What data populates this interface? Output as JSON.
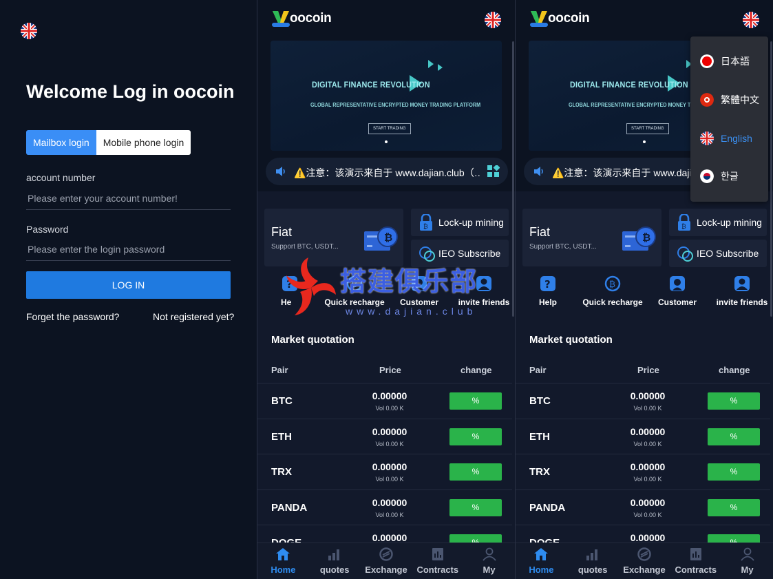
{
  "login": {
    "welcome": "Welcome Log in oocoin",
    "tabs": [
      "Mailbox login",
      "Mobile phone login"
    ],
    "account_label": "account number",
    "account_placeholder": "Please enter your account number!",
    "password_label": "Password",
    "password_placeholder": "Please enter the login password",
    "login_button": "LOG IN",
    "forget": "Forget the password?",
    "register": "Not registered yet?"
  },
  "home": {
    "brand": "oocoin",
    "banner": {
      "title": "DIGITAL FINANCE REVOLUTION",
      "subtitle": "GLOBAL REPRESENTATIVE ENCRYPTED MONEY TRADING PLATFORM",
      "button": "START TRADING"
    },
    "notice": "⚠️注意：该演示来自于 www.dajian.club（…",
    "fiat": {
      "title": "Fiat",
      "subtitle": "Support BTC, USDT..."
    },
    "services": [
      "Lock-up mining",
      "IEO Subscribe"
    ],
    "quick": [
      "Help",
      "Quick recharge",
      "Customer",
      "invite friends"
    ],
    "quick_partial": [
      "He",
      "Quick recharge",
      "Customer",
      "invite friends"
    ],
    "market": {
      "title": "Market quotation",
      "headers": [
        "Pair",
        "Price",
        "change"
      ],
      "rows": [
        {
          "pair": "BTC",
          "price": "0.00000",
          "vol": "Vol 0.00 K",
          "change": "%"
        },
        {
          "pair": "ETH",
          "price": "0.00000",
          "vol": "Vol 0.00 K",
          "change": "%"
        },
        {
          "pair": "TRX",
          "price": "0.00000",
          "vol": "Vol 0.00 K",
          "change": "%"
        },
        {
          "pair": "PANDA",
          "price": "0.00000",
          "vol": "Vol 0.00 K",
          "change": "%"
        },
        {
          "pair": "DOGE",
          "price": "0.00000",
          "vol": "",
          "change": "%"
        }
      ]
    },
    "nav": [
      "Home",
      "quotes",
      "Exchange",
      "Contracts",
      "My"
    ]
  },
  "languages": [
    "日本語",
    "繁體中文",
    "English",
    "한글"
  ],
  "watermark": {
    "text": "搭建俱乐部",
    "url": "www.dajian.club"
  },
  "colors": {
    "accent": "#1f7ae0",
    "tab_active": "#3a8ef6",
    "change_green": "#2ab34a",
    "nav_active": "#2e8cf0"
  }
}
